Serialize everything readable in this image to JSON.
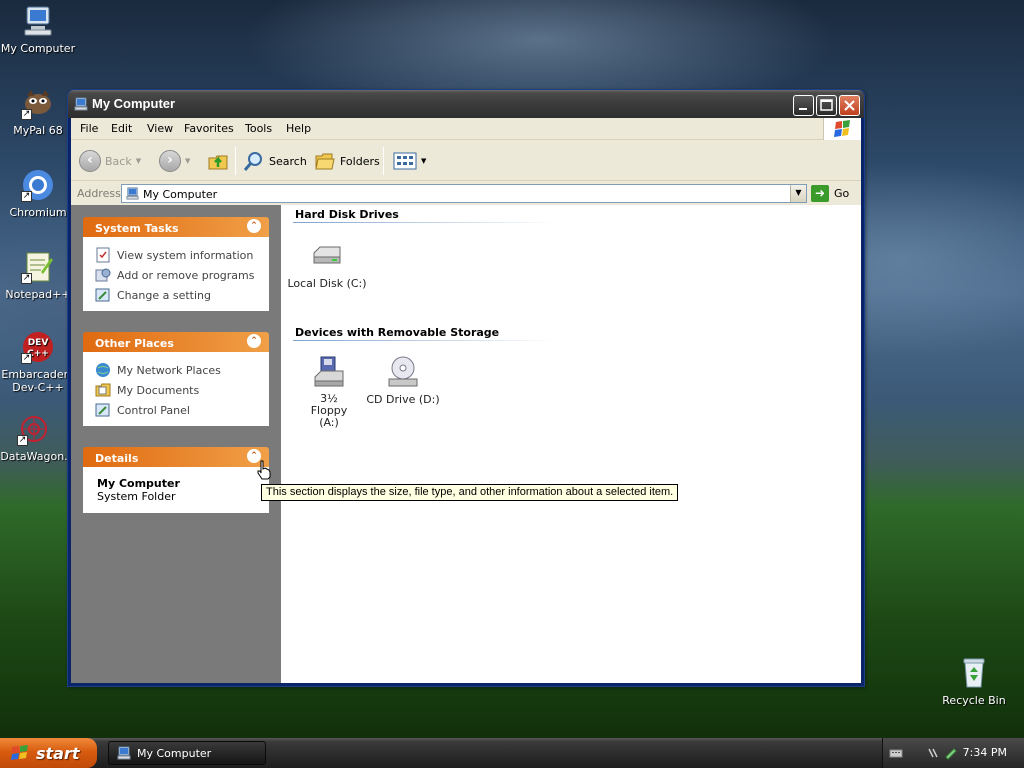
{
  "desktop": {
    "icons": [
      {
        "label": "My Computer"
      },
      {
        "label": "MyPal 68"
      },
      {
        "label": "Chromium"
      },
      {
        "label": "Notepad++"
      },
      {
        "label": "Embarcadero Dev-C++"
      },
      {
        "label": "DataWagon."
      },
      {
        "label": "Recycle Bin"
      }
    ]
  },
  "window": {
    "title": "My Computer",
    "menu": [
      "File",
      "Edit",
      "View",
      "Favorites",
      "Tools",
      "Help"
    ],
    "toolbar": {
      "back_label": "Back",
      "search_label": "Search",
      "folders_label": "Folders"
    },
    "address": {
      "label": "Address",
      "value": "My Computer",
      "go_label": "Go"
    },
    "panels": {
      "system_tasks": {
        "title": "System Tasks",
        "items": [
          "View system information",
          "Add or remove programs",
          "Change a setting"
        ]
      },
      "other_places": {
        "title": "Other Places",
        "items": [
          "My Network Places",
          "My Documents",
          "Control Panel"
        ]
      },
      "details": {
        "title": "Details",
        "name": "My Computer",
        "type": "System Folder"
      }
    },
    "groups": {
      "hard_disks": {
        "title": "Hard Disk Drives",
        "items": [
          "Local Disk (C:)"
        ]
      },
      "removable": {
        "title": "Devices with Removable Storage",
        "items": [
          "3½ Floppy (A:)",
          "CD Drive (D:)"
        ]
      }
    },
    "tooltip": "This section displays the size, file type, and other information about a selected item."
  },
  "taskbar": {
    "start_label": "start",
    "task_label": "My Computer",
    "clock": "7:34 PM"
  },
  "colors": {
    "titlebar": "#3b3b3b",
    "panel_header": "#e06a10",
    "left_pane": "#7a7a7a",
    "start_button": "#d85c10"
  }
}
